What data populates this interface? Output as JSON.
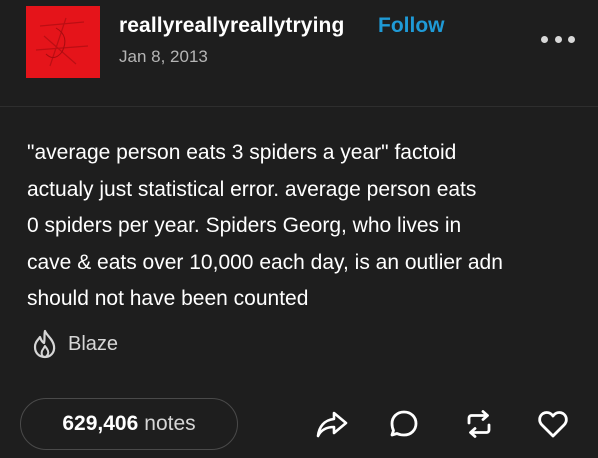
{
  "post": {
    "username": "reallyreallyreallytrying",
    "follow_label": "Follow",
    "date": "Jan 8, 2013",
    "more_icon": "more-horizontal-icon",
    "body": "\"average person eats 3 spiders a year\" factoid\nactualy just statistical error. average person eats\n0 spiders per year. Spiders Georg, who lives in\ncave & eats over 10,000 each day, is an outlier adn\nshould not have been counted"
  },
  "blaze": {
    "label": "Blaze",
    "icon": "flame-icon"
  },
  "footer": {
    "notes_count": "629,406",
    "notes_label": "notes",
    "actions": [
      "share-icon",
      "reply-icon",
      "reblog-icon",
      "like-icon"
    ]
  },
  "colors": {
    "background": "#1e1e1e",
    "avatar": "#e5141a",
    "follow": "#1f9ad6",
    "text": "#ffffff",
    "muted": "#b5b5b5"
  }
}
